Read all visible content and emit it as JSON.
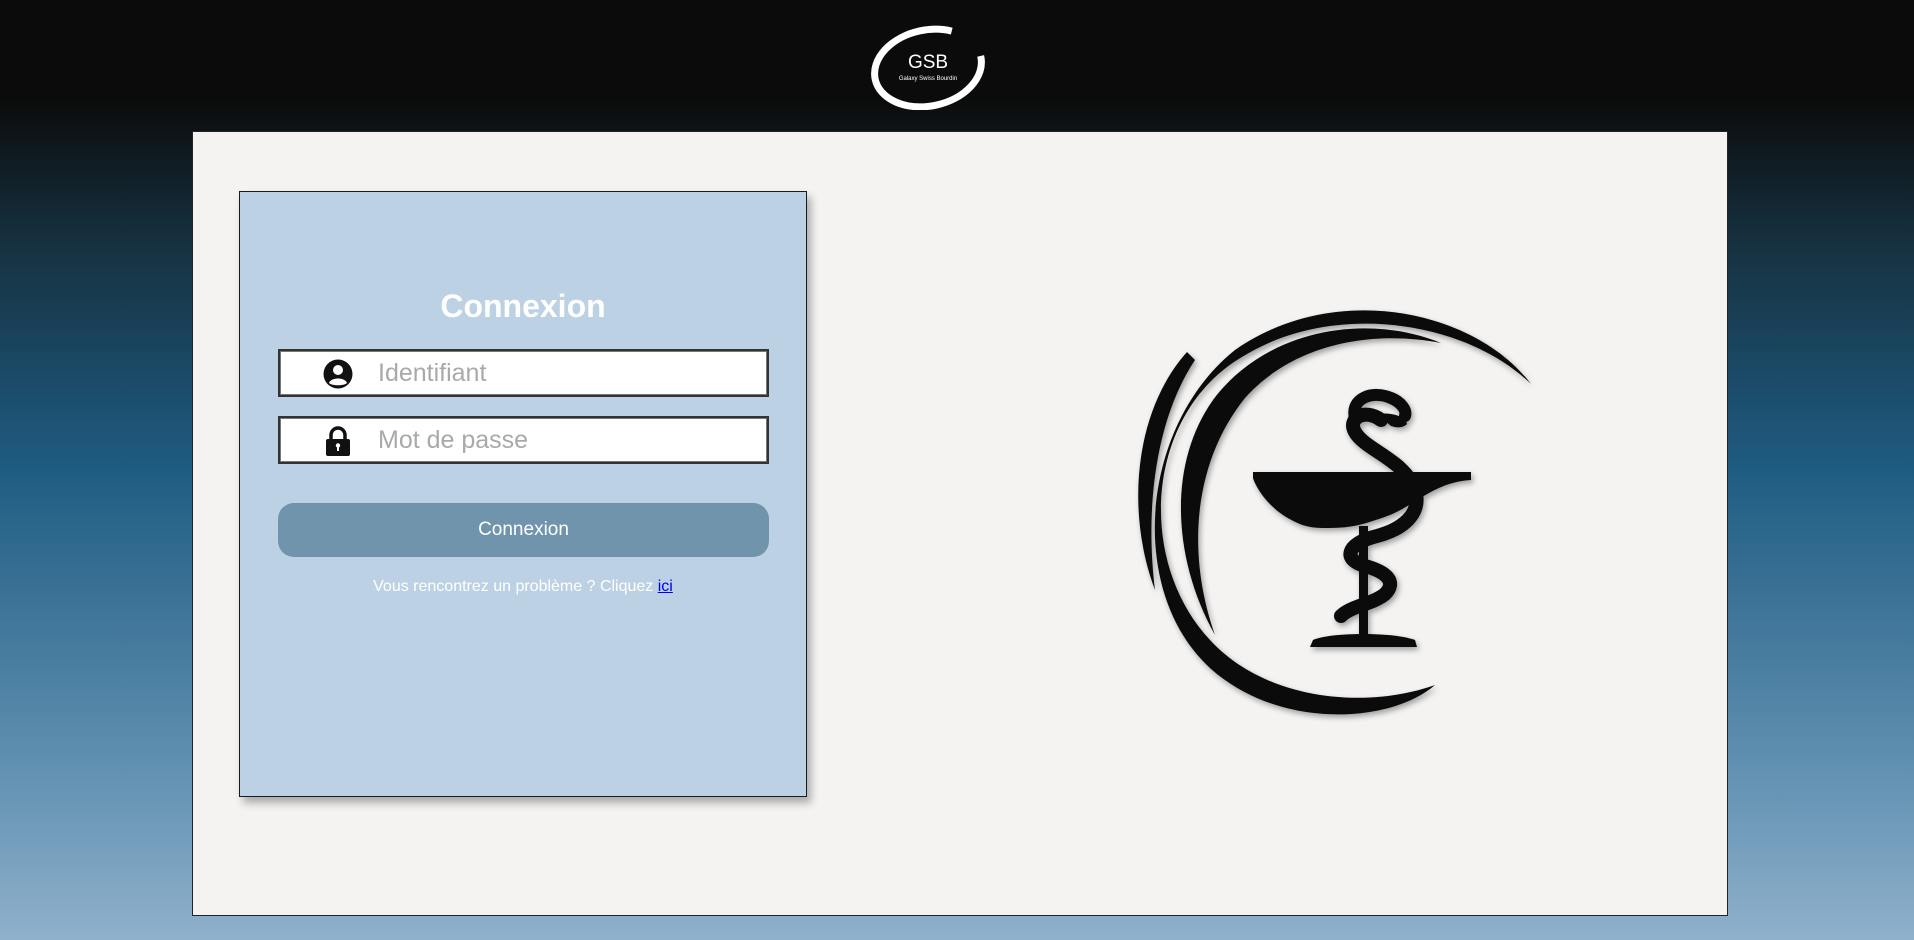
{
  "header": {
    "logo": {
      "icon": "gsb-logo",
      "title": "GSB",
      "subtitle": "Galaxy Swiss Bourdin"
    }
  },
  "login": {
    "title": "Connexion",
    "username": {
      "icon": "user-circle-icon",
      "placeholder": "Identifiant",
      "value": ""
    },
    "password": {
      "icon": "lock-icon",
      "placeholder": "Mot de passe",
      "value": ""
    },
    "submit_label": "Connexion",
    "help_text": "Vous rencontrez un problème ? Cliquez ",
    "help_link_label": "ici"
  },
  "illustration": {
    "icon": "pharmacy-caduceus-emblem"
  },
  "colors": {
    "header_bg": "#0b0b0b",
    "panel_bg": "#f4f3f2",
    "card_bg": "#bcd2e4",
    "button_bg": "#6f94ab",
    "link": "#0000ee"
  }
}
